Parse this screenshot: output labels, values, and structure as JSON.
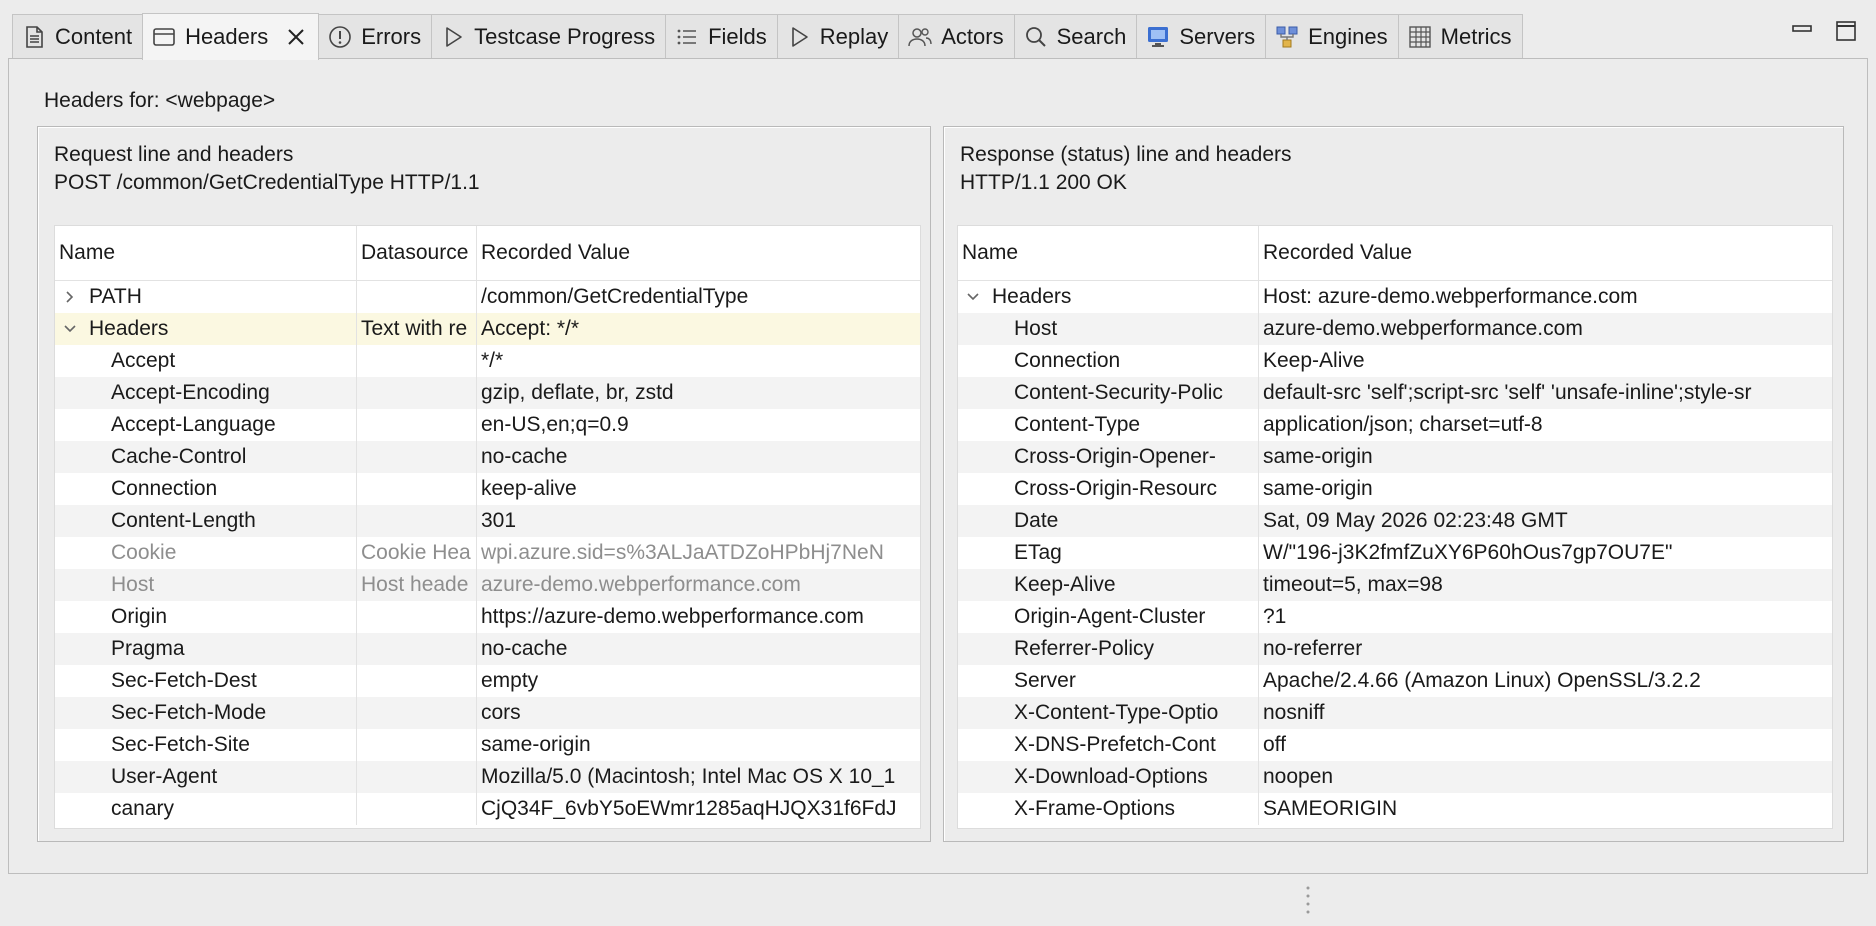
{
  "tabs": [
    {
      "label": "Content",
      "icon": "document-icon",
      "active": false
    },
    {
      "label": "Headers",
      "icon": "headers-icon",
      "active": true
    },
    {
      "label": "Errors",
      "icon": "error-icon",
      "active": false
    },
    {
      "label": "Testcase Progress",
      "icon": "play-icon",
      "active": false
    },
    {
      "label": "Fields",
      "icon": "list-icon",
      "active": false
    },
    {
      "label": "Replay",
      "icon": "play-icon",
      "active": false
    },
    {
      "label": "Actors",
      "icon": "users-icon",
      "active": false
    },
    {
      "label": "Search",
      "icon": "search-icon",
      "active": false
    },
    {
      "label": "Servers",
      "icon": "monitor-icon",
      "active": false
    },
    {
      "label": "Engines",
      "icon": "engines-icon",
      "active": false
    },
    {
      "label": "Metrics",
      "icon": "grid-icon",
      "active": false
    }
  ],
  "headers_for": "Headers for: <webpage>",
  "request": {
    "title": "Request line and headers",
    "line": "POST /common/GetCredentialType HTTP/1.1",
    "columns": [
      "Name",
      "Datasource",
      "Recorded Value"
    ],
    "rows": [
      {
        "name": "PATH",
        "datasource": "",
        "value": "/common/GetCredentialType",
        "level": 0,
        "twisty": "collapsed"
      },
      {
        "name": "Headers",
        "datasource": "Text with re",
        "value": "Accept: */*",
        "level": 0,
        "twisty": "expanded",
        "selected": true
      },
      {
        "name": "Accept",
        "datasource": "",
        "value": "*/*",
        "level": 1
      },
      {
        "name": "Accept-Encoding",
        "datasource": "",
        "value": "gzip, deflate, br, zstd",
        "level": 1
      },
      {
        "name": "Accept-Language",
        "datasource": "",
        "value": "en-US,en;q=0.9",
        "level": 1
      },
      {
        "name": "Cache-Control",
        "datasource": "",
        "value": "no-cache",
        "level": 1
      },
      {
        "name": "Connection",
        "datasource": "",
        "value": "keep-alive",
        "level": 1
      },
      {
        "name": "Content-Length",
        "datasource": "",
        "value": "301",
        "level": 1
      },
      {
        "name": "Cookie",
        "datasource": "Cookie Hea",
        "value": "wpi.azure.sid=s%3ALJaATDZoHPbHj7NeN",
        "level": 1,
        "disabled": true
      },
      {
        "name": "Host",
        "datasource": "Host heade",
        "value": "azure-demo.webperformance.com",
        "level": 1,
        "disabled": true
      },
      {
        "name": "Origin",
        "datasource": "",
        "value": "https://azure-demo.webperformance.com",
        "level": 1
      },
      {
        "name": "Pragma",
        "datasource": "",
        "value": "no-cache",
        "level": 1
      },
      {
        "name": "Sec-Fetch-Dest",
        "datasource": "",
        "value": "empty",
        "level": 1
      },
      {
        "name": "Sec-Fetch-Mode",
        "datasource": "",
        "value": "cors",
        "level": 1
      },
      {
        "name": "Sec-Fetch-Site",
        "datasource": "",
        "value": "same-origin",
        "level": 1
      },
      {
        "name": "User-Agent",
        "datasource": "",
        "value": "Mozilla/5.0 (Macintosh; Intel Mac OS X 10_1",
        "level": 1
      },
      {
        "name": "canary",
        "datasource": "",
        "value": "CjQ34F_6vbY5oEWmr1285aqHJQX31f6FdJ",
        "level": 1
      }
    ]
  },
  "response": {
    "title": "Response (status) line and headers",
    "line": "HTTP/1.1 200 OK",
    "columns": [
      "Name",
      "Recorded Value"
    ],
    "rows": [
      {
        "name": "Headers",
        "value": "Host: azure-demo.webperformance.com",
        "level": 0,
        "twisty": "expanded"
      },
      {
        "name": "Host",
        "value": "azure-demo.webperformance.com",
        "level": 1
      },
      {
        "name": "Connection",
        "value": "Keep-Alive",
        "level": 1
      },
      {
        "name": "Content-Security-Polic",
        "value": "default-src 'self';script-src 'self' 'unsafe-inline';style-sr",
        "level": 1
      },
      {
        "name": "Content-Type",
        "value": "application/json; charset=utf-8",
        "level": 1
      },
      {
        "name": "Cross-Origin-Opener-",
        "value": "same-origin",
        "level": 1
      },
      {
        "name": "Cross-Origin-Resourc",
        "value": "same-origin",
        "level": 1
      },
      {
        "name": "Date",
        "value": "Sat, 09 May 2026 02:23:48 GMT",
        "level": 1
      },
      {
        "name": "ETag",
        "value": "W/\"196-j3K2fmfZuXY6P60hOus7gp7OU7E\"",
        "level": 1
      },
      {
        "name": "Keep-Alive",
        "value": "timeout=5, max=98",
        "level": 1
      },
      {
        "name": "Origin-Agent-Cluster",
        "value": "?1",
        "level": 1
      },
      {
        "name": "Referrer-Policy",
        "value": "no-referrer",
        "level": 1
      },
      {
        "name": "Server",
        "value": "Apache/2.4.66 (Amazon Linux) OpenSSL/3.2.2",
        "level": 1
      },
      {
        "name": "X-Content-Type-Optio",
        "value": "nosniff",
        "level": 1
      },
      {
        "name": "X-DNS-Prefetch-Cont",
        "value": "off",
        "level": 1
      },
      {
        "name": "X-Download-Options",
        "value": "noopen",
        "level": 1
      },
      {
        "name": "X-Frame-Options",
        "value": "SAMEORIGIN",
        "level": 1
      }
    ]
  },
  "colors": {
    "selected_row": "#fbf8e1",
    "striped_row": "#f3f3f3",
    "disabled_text": "#8e8e8e",
    "icon_blue": "#3b6fd1"
  }
}
